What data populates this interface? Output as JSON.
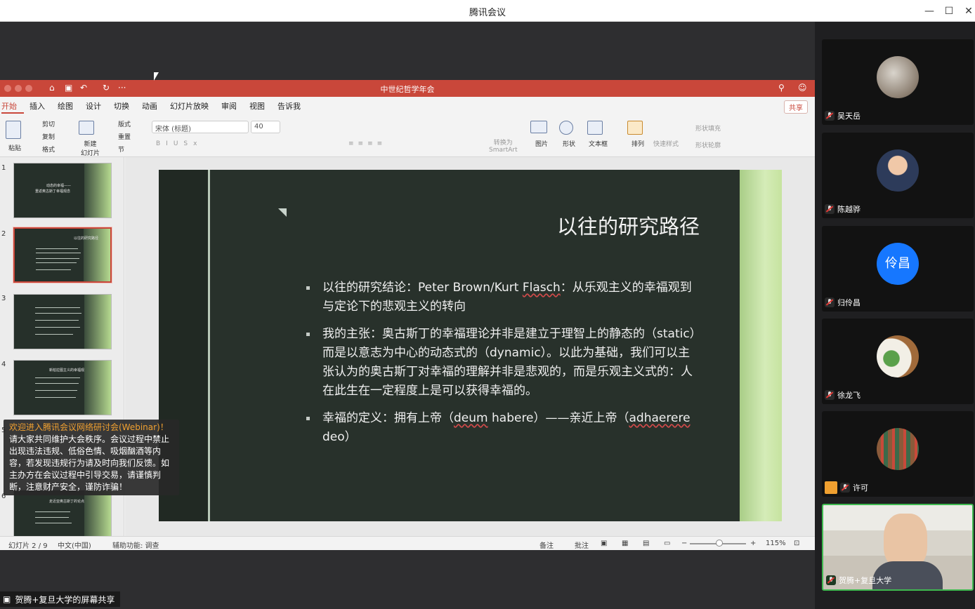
{
  "window": {
    "title": "腾讯会议",
    "minimize": "—",
    "maximize": "☐",
    "close": "✕"
  },
  "ppt": {
    "doc_title": "中世纪哲学年会",
    "tabs": [
      "开始",
      "插入",
      "绘图",
      "设计",
      "切换",
      "动画",
      "幻灯片放映",
      "审阅",
      "视图",
      "告诉我"
    ],
    "share_label": "共享",
    "ribbon": {
      "paste": "粘贴",
      "cut": "剪切",
      "copy": "复制",
      "format": "格式",
      "new_slide": "新建\n幻灯片",
      "layout": "版式",
      "reset": "重置",
      "section": "节",
      "font_name": "宋体 (标题)",
      "font_size": "40",
      "smartart": "转换为\nSmartArt",
      "picture": "图片",
      "shape": "形状",
      "textbox": "文本框",
      "arrange": "排列",
      "quick_style": "快速样式",
      "shape_fill": "形状填充",
      "shape_outline": "形状轮廓"
    },
    "thumbnails": [
      {
        "num": "1",
        "title": "动态的幸福——",
        "sub": "重返奥古斯丁幸福观念"
      },
      {
        "num": "2",
        "title": "以往的研究路径",
        "sub": ""
      },
      {
        "num": "3",
        "title": "",
        "sub": ""
      },
      {
        "num": "4",
        "title": "新柏拉图主义的幸福观",
        "sub": ""
      },
      {
        "num": "5",
        "title": "",
        "sub": ""
      },
      {
        "num": "6",
        "title": "走近亚奥古斯丁的论点",
        "sub": ""
      }
    ],
    "slide": {
      "title": "以往的研究路径",
      "bullets": [
        {
          "pre": "以往的研究结论：Peter Brown/Kurt ",
          "ul": "Flasch",
          "post": "：从乐观主义的幸福观到与定论下的悲观主义的转向"
        },
        {
          "pre": "我的主张：奥古斯丁的幸福理论并非是建立于理智上的静态的（static）而是以意志为中心的动态式的（dynamic）。以此为基础，我们可以主张认为的奥古斯丁对幸福的理解并非是悲观的，而是乐观主义式的：人在此生在一定程度上是可以获得幸福的。",
          "ul": "",
          "post": ""
        },
        {
          "pre": "幸福的定义：拥有上帝（",
          "ul": "deum",
          "post": " habere）——亲近上帝（",
          "ul2": "adhaerere",
          "post2": " deo）"
        }
      ]
    },
    "status": {
      "slide_indicator": "幻灯片 2 / 9",
      "language": "中文(中国)",
      "accessibility": "辅助功能: 调查",
      "notes": "备注",
      "comments": "批注",
      "zoom": "115%"
    }
  },
  "notice": {
    "headline": "欢迎进入腾讯会议网络研讨会(Webinar)！",
    "body": "请大家共同维护大会秩序。会议过程中禁止出现违法违规、低俗色情、吸烟酗酒等内容，若发现违规行为请及时向我们反馈。如主办方在会议过程中引导交易，请谨慎判断，注意财产安全，谨防诈骗！"
  },
  "share_tag": "贺腾+复旦大学的屏幕共享",
  "participants": [
    {
      "name": "吴天岳",
      "avatar": "cat-photo"
    },
    {
      "name": "陈越骅",
      "avatar": "portrait-photo"
    },
    {
      "name": "归伶昌",
      "avatar_text": "伶昌",
      "avatar_color": "#1677ff"
    },
    {
      "name": "徐龙飞",
      "avatar": "cartoon-photo"
    },
    {
      "name": "许可",
      "avatar": "street-photo"
    },
    {
      "name": "贺腾+复旦大学",
      "avatar": "live-video"
    }
  ]
}
